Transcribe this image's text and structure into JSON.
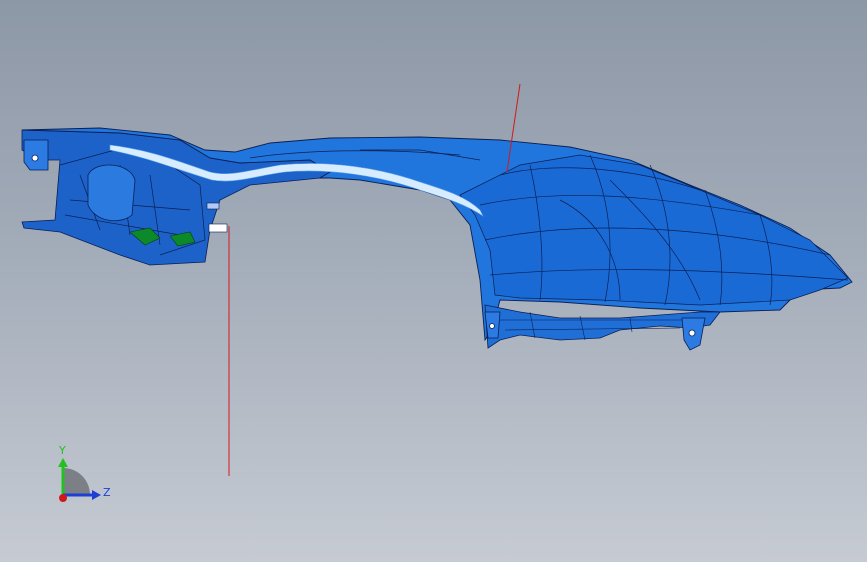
{
  "viewport": {
    "background_top": "#8d98a7",
    "background_bottom": "#c6cbd3",
    "part_color": "#1f6fd6",
    "part_dark": "#0d47a8",
    "part_light": "#3d8ef0",
    "highlight_color": "#cfe8ff",
    "edge_color": "#0a1f55",
    "leader_color": "#d11a1a",
    "inner_detail_color": "#0c8a2a"
  },
  "triad": {
    "y_label": "Y",
    "z_label": "Z",
    "y_color": "#22c022",
    "z_color": "#1c3fd6",
    "x_color": "#d01818",
    "icons": [
      "axis-triad-icon"
    ]
  }
}
